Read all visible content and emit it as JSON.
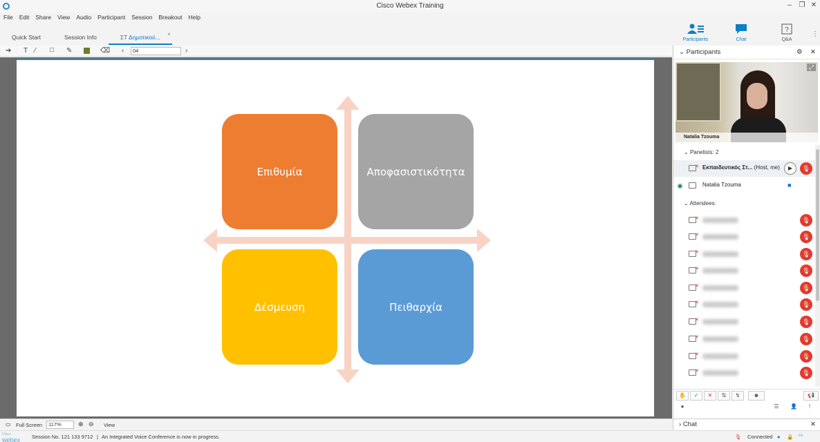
{
  "window": {
    "title": "Cisco Webex Training"
  },
  "menu": [
    "File",
    "Edit",
    "Share",
    "View",
    "Audio",
    "Participant",
    "Session",
    "Breakout",
    "Help"
  ],
  "tabs": [
    {
      "label": "Quick Start"
    },
    {
      "label": "Session Info"
    },
    {
      "label": "ΣΤ Δημοτικού...",
      "active": true
    }
  ],
  "panel_buttons": {
    "participants": "Participants",
    "chat": "Chat",
    "qa": "Q&A"
  },
  "annotation": {
    "page_value": "04"
  },
  "slide": {
    "boxes": [
      {
        "label": "Επιθυμία",
        "color": "#ed7d31"
      },
      {
        "label": "Αποφασιστικότητα",
        "color": "#a5a5a5"
      },
      {
        "label": "Δέσμευση",
        "color": "#ffc000"
      },
      {
        "label": "Πειθαρχία",
        "color": "#5b9bd5"
      }
    ],
    "arrow_color": "#f8d3c4"
  },
  "participants_panel": {
    "title": "Participants",
    "video_name": "Natalia Tzouma",
    "panelists_label": "Panelists: 2",
    "host_name": "Εκπαιδευτικός Στ...",
    "host_role": "(Host, me)",
    "panelist2": "Natalia Tzouma",
    "attendees_label": "Attendees:"
  },
  "chat_panel": {
    "title": "Chat"
  },
  "bottom": {
    "fullscreen": "Full Screen",
    "zoom": "117%",
    "view": "View"
  },
  "status": {
    "logo_top": "Cisco",
    "logo_bottom": "webex",
    "session": "Session No. 121 133 9712",
    "separator": "|",
    "voice": "An Integrated Voice Conference is now in progress.",
    "connected": "Connected"
  }
}
